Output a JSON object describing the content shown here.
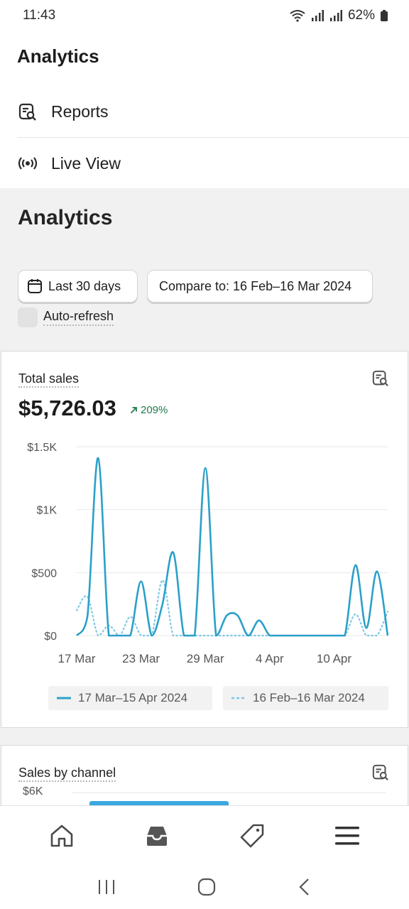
{
  "status": {
    "time": "11:43",
    "battery": "62%"
  },
  "nav": {
    "title": "Analytics",
    "items": [
      {
        "label": "Reports",
        "icon": "report-search-icon"
      },
      {
        "label": "Live View",
        "icon": "broadcast-icon"
      }
    ]
  },
  "page": {
    "title": "Analytics",
    "date_range_label": "Last 30 days",
    "compare_label": "Compare to: 16 Feb–16 Mar 2024",
    "auto_refresh_label": "Auto-refresh",
    "auto_refresh_checked": false
  },
  "total_sales_card": {
    "title": "Total sales",
    "value": "$5,726.03",
    "change": "209%",
    "change_direction": "up",
    "change_color": "#1f7a4b"
  },
  "chart_data": {
    "type": "line",
    "y_ticks": [
      "$1.5K",
      "$1K",
      "$500",
      "$0"
    ],
    "ylim": [
      0,
      1500
    ],
    "x_ticks": [
      "17 Mar",
      "23 Mar",
      "29 Mar",
      "4 Apr",
      "10 Apr"
    ],
    "x": [
      "17 Mar",
      "18 Mar",
      "19 Mar",
      "20 Mar",
      "21 Mar",
      "22 Mar",
      "23 Mar",
      "24 Mar",
      "25 Mar",
      "26 Mar",
      "27 Mar",
      "28 Mar",
      "29 Mar",
      "30 Mar",
      "31 Mar",
      "1 Apr",
      "2 Apr",
      "3 Apr",
      "4 Apr",
      "5 Apr",
      "6 Apr",
      "7 Apr",
      "8 Apr",
      "9 Apr",
      "10 Apr",
      "11 Apr",
      "12 Apr",
      "13 Apr",
      "14 Apr",
      "15 Apr"
    ],
    "series": [
      {
        "name": "17 Mar–15 Apr 2024",
        "style": "solid",
        "color": "#2ba0c9",
        "values": [
          0,
          150,
          1410,
          0,
          0,
          0,
          430,
          0,
          250,
          660,
          0,
          0,
          1330,
          0,
          160,
          160,
          0,
          120,
          0,
          0,
          0,
          0,
          0,
          0,
          0,
          0,
          560,
          60,
          510,
          0
        ]
      },
      {
        "name": "16 Feb–16 Mar 2024",
        "style": "dotted",
        "color": "#7cc8e6",
        "values": [
          200,
          310,
          0,
          80,
          0,
          150,
          0,
          0,
          440,
          0,
          0,
          0,
          0,
          0,
          0,
          0,
          0,
          0,
          0,
          0,
          0,
          0,
          0,
          0,
          0,
          0,
          170,
          0,
          0,
          190
        ]
      }
    ]
  },
  "channel_card": {
    "title": "Sales by channel",
    "y_tick": "$6K",
    "bar_color": "#3ba7e0"
  },
  "tab_bar": [
    {
      "icon": "home-icon"
    },
    {
      "icon": "inbox-icon"
    },
    {
      "icon": "tag-icon"
    },
    {
      "icon": "menu-icon"
    }
  ],
  "system_nav": [
    {
      "icon": "recent-apps-icon"
    },
    {
      "icon": "home-circle-icon"
    },
    {
      "icon": "back-chevron-icon"
    }
  ]
}
